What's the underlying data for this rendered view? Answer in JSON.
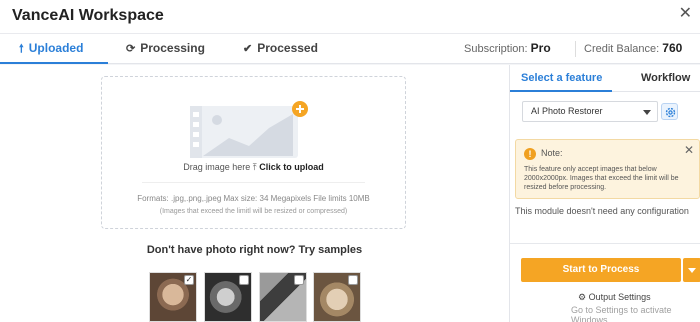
{
  "app": {
    "title": "VanceAI Workspace",
    "close_icon": "close-icon"
  },
  "tabs": [
    {
      "label": "Uploaded",
      "icon": "up-arrow-icon",
      "active": true
    },
    {
      "label": "Processing",
      "icon": "refresh-icon",
      "active": false
    },
    {
      "label": "Processed",
      "icon": "check-circle-icon",
      "active": false
    }
  ],
  "account": {
    "subscription_label": "Subscription:",
    "subscription_value": "Pro",
    "credit_label": "Credit Balance:",
    "credit_value": "760"
  },
  "upload": {
    "drag_text": "Drag image here",
    "click_text": "Click to upload",
    "formats": "Formats: .jpg,.png,.jpeg Max size: 34 Megapixels File limits 10MB",
    "note": "(Images that exceed the limitl will be resized or compressed)"
  },
  "samples": {
    "title": "Don't have photo right now? Try samples",
    "items": [
      {
        "checked": true
      },
      {
        "checked": false
      },
      {
        "checked": false
      },
      {
        "checked": false
      }
    ]
  },
  "sidebar": {
    "tabs": [
      {
        "label": "Select a feature",
        "active": true
      },
      {
        "label": "Workflow",
        "active": false
      }
    ],
    "feature_selected": "AI Photo Restorer",
    "note_title": "Note:",
    "note_text": "This feature only accept images that below 2000x2000px. Images that exceed the limit will be resized before processing.",
    "no_config": "This module doesn't need any configuration",
    "start_button": "Start to Process",
    "output_settings": "Output Settings",
    "activate_text": "Go to Settings to activate Windows."
  },
  "colors": {
    "accent_blue": "#2b7fd8",
    "accent_orange": "#f5a524",
    "note_bg": "#fdf3de"
  }
}
